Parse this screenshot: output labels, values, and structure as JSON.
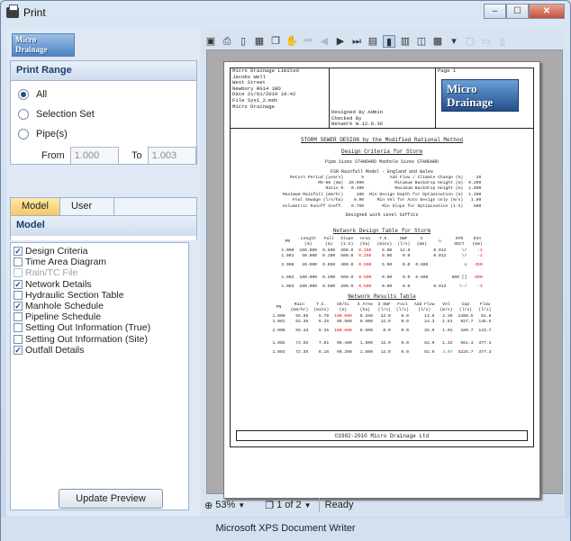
{
  "window": {
    "title": "Print",
    "min": "–",
    "max": "☐",
    "close": "✕"
  },
  "logo": {
    "line1": "Micro",
    "line2": "Drainage"
  },
  "print_range": {
    "title": "Print Range",
    "options": [
      {
        "label": "All",
        "selected": true
      },
      {
        "label": "Selection Set",
        "selected": false
      },
      {
        "label": "Pipe(s)",
        "selected": false
      }
    ],
    "from_label": "From",
    "from_value": "1.000",
    "to_label": "To",
    "to_value": "1.003"
  },
  "tabs": [
    {
      "label": "Model",
      "active": true
    },
    {
      "label": "User",
      "active": false
    }
  ],
  "model": {
    "title": "Model",
    "items": [
      {
        "label": "Design Criteria",
        "checked": true,
        "enabled": true
      },
      {
        "label": "Time Area Diagram",
        "checked": false,
        "enabled": true
      },
      {
        "label": "Rain/TC File",
        "checked": false,
        "enabled": false
      },
      {
        "label": "Network Details",
        "checked": true,
        "enabled": true
      },
      {
        "label": "Hydraulic Section Table",
        "checked": false,
        "enabled": true
      },
      {
        "label": "Manhole Schedule",
        "checked": true,
        "enabled": true
      },
      {
        "label": "Pipeline Schedule",
        "checked": false,
        "enabled": true
      },
      {
        "label": "Setting Out Information (True)",
        "checked": false,
        "enabled": true
      },
      {
        "label": "Setting Out Information (Site)",
        "checked": false,
        "enabled": true
      },
      {
        "label": "Outfall Details",
        "checked": true,
        "enabled": true
      }
    ]
  },
  "update_button": "Update Preview",
  "status": {
    "zoom": "53%",
    "page": "1 of 2",
    "state": "Ready"
  },
  "printer": "Microsoft XPS Document Writer",
  "doc": {
    "hdr_left": [
      "Micro Drainage Limited",
      "Jacobs Well",
      "West Street",
      "Newbury  RG14 1BD",
      "Date 21/01/2010 10:42",
      "File Sys1_2.mdx",
      "Micro Drainage"
    ],
    "hdr_mid": [
      "Designed By Admin",
      "Checked By",
      "Network W.12.0.36"
    ],
    "page_label": "Page 1",
    "logo1": "Micro",
    "logo2": "Drainage",
    "title": "STORM SEWER DESIGN by the Modified Rational Method",
    "criteria_title": "Design Criteria for Storm",
    "pipe_sizes": "Pipe Sizes STANDARD Manhole Sizes STANDARD",
    "fsr": "FSR Rainfall Model - England and Wales",
    "criteria_rows": [
      [
        "Return Period (years)",
        "5",
        "Add Flow / Climate Change (%)",
        "20"
      ],
      [
        "M5-60 (mm)",
        "20.000",
        "Minimum Backdrop Height (m)",
        "0.200"
      ],
      [
        "Ratio R",
        "0.400",
        "Maximum Backdrop Height (m)",
        "1.500"
      ],
      [
        "Maximum Rainfall (mm/hr)",
        "100",
        "Min Design Depth for Optimisation (m)",
        "1.200"
      ],
      [
        "Foul Sewage (l/s/ha)",
        "0.00",
        "Min Vel for Auto Design only (m/s)",
        "1.00"
      ],
      [
        "Volumetric Runoff Coeff.",
        "0.750",
        "Min Slope for Optimisation (1:X)",
        "500"
      ]
    ],
    "level_soffits": "Designed with Level Soffits",
    "design_table_title": "Network Design Table for Storm",
    "design_head": [
      "PN",
      "Length\n(m)",
      "Fall\n(m)",
      "Slope\n(1:X)",
      "Area\n(ha)",
      "T.E.\n(mins)",
      "DWF\n(l/s)",
      "k\n(mm)",
      "n",
      "HYD\nSECT",
      "DIA\n(mm)"
    ],
    "design_rows": [
      [
        "1.000",
        "100.000",
        "0.500",
        "200.0",
        "0.250",
        "5.00",
        "12.0",
        "",
        "0.012",
        "\\/",
        "-1"
      ],
      [
        "1.001",
        "50.000",
        "0.100",
        "500.0",
        "0.250",
        "0.00",
        "0.0",
        "",
        "0.012",
        "\\/",
        "-1"
      ],
      [
        "2.000",
        "20.000",
        "0.050",
        "400.0",
        "0.500",
        "5.00",
        "0.0",
        "0.600",
        "",
        "o",
        "450"
      ],
      [
        "1.002",
        "100.000",
        "0.200",
        "500.0",
        "0.500",
        "0.00",
        "0.0",
        "0.600",
        "",
        "600 []",
        "600"
      ],
      [
        "1.003",
        "100.000",
        "0.500",
        "200.0",
        "0.500",
        "0.00",
        "0.0",
        "",
        "0.012",
        "\\-/",
        "-3"
      ]
    ],
    "results_title": "Network Results Table",
    "results_head": [
      "PN",
      "Rain\n(mm/hr)",
      "T.C.\n(mins)",
      "US/IL\n(m)",
      "Σ Area\n(ha)",
      "Σ DWF\n(l/s)",
      "Foul\n(l/s)",
      "Add Flow\n(l/s)",
      "Vel\n(m/s)",
      "Cap\n(l/s)",
      "Flow\n(l/s)"
    ],
    "results_rows": [
      [
        "1.000",
        "55.85",
        "5.70",
        "100.000",
        "0.250",
        "12.0",
        "0.0",
        "13.6",
        "2.39",
        "1488.5",
        "51.8"
      ],
      [
        "1.001",
        "52.36",
        "6.25",
        "99.500",
        "0.500",
        "12.0",
        "0.0",
        "24.3",
        "1.51",
        "927.7",
        "145.5"
      ],
      [
        "2.000",
        "55.43",
        "5.35",
        "100.500",
        "0.500",
        "0.0",
        "0.0",
        "25.9",
        "1.01",
        "160.7",
        "143.7"
      ],
      [
        "1.002",
        "74.92",
        "7.01",
        "99.400",
        "1.500",
        "12.0",
        "0.0",
        "62.9",
        "1.32",
        "561.4",
        "377.3"
      ],
      [
        "1.003",
        "72.35",
        "8.16",
        "99.200",
        "1.500",
        "12.0",
        "0.0",
        "62.9",
        "3.07",
        "3225.7",
        "377.3"
      ]
    ],
    "footer": "©1982-2010 Micro Drainage Ltd"
  }
}
